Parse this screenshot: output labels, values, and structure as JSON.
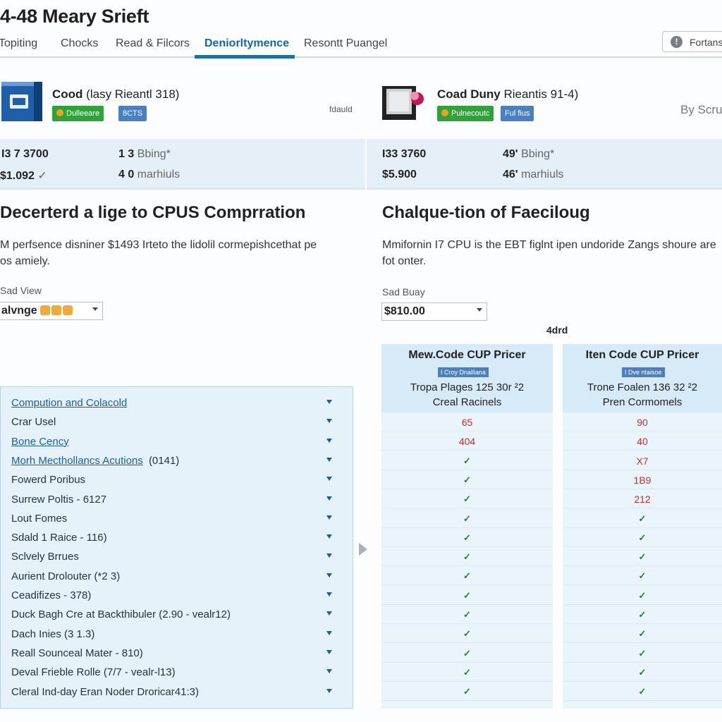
{
  "page": {
    "title": "4-48 Meary Srieft"
  },
  "tabs": [
    {
      "label": "Topiting",
      "active": false
    },
    {
      "label": "Chocks",
      "active": false
    },
    {
      "label": "Read & Filcors",
      "active": false
    },
    {
      "label": "Deniorltymence",
      "active": true
    },
    {
      "label": "Resontt Puangel",
      "active": false
    }
  ],
  "toolbar": {
    "button_label": "Fortans",
    "button_icon": "info-icon"
  },
  "products": [
    {
      "name_bold": "Cood",
      "name_rest": "(lasy  Rieantl  318)",
      "badge_primary": "Dulleeare",
      "badge_secondary": "8CTS",
      "note": "fdauld",
      "spec1_label": "I3 7  3700",
      "spec1_value": "1 3",
      "spec1_unit": "Bbing*",
      "spec2_label": "$1.092",
      "spec2_mark": "✓",
      "spec2_value": "4 0",
      "spec2_unit": "marhiuls",
      "section_title": "Decerterd a lige to CPUS Comprration",
      "section_text": "M perfsence disniner $1493 Irteto the lidolil cormepishcethat pe os amiely.",
      "field_label": "Sad View",
      "field_value": "alvnge",
      "brand_color": "#1d5fa8"
    },
    {
      "name_bold": "Coad Duny",
      "name_rest": "Rieantis 91-4)",
      "badge_primary": "Pulnecoutc",
      "badge_secondary": "Ful fius",
      "scroll_hint": "By Scru",
      "spec1_label": "I33  3760",
      "spec1_value": "49'",
      "spec1_unit": "Bbing*",
      "spec2_label": "$5.900",
      "spec2_value": "46'",
      "spec2_unit": "marhiuls",
      "section_title": "Chalque-tion of Faeciloug",
      "section_text": "Mmifornin I7 CPU is the EBT figlnt ipen undoride Zangs shoure are fot onter.",
      "field_label": "Sad Buay",
      "field_value": "$810.00",
      "brand_color": "#9a1d4f"
    }
  ],
  "aside_label": "4drd",
  "features": [
    {
      "label": "Compution and Colacold",
      "link": true
    },
    {
      "label": "Crar  Usel",
      "link": false
    },
    {
      "label": "Bone Cency",
      "link": true
    },
    {
      "label": "Morh Mecthollancs Acutions",
      "suffix": "(0141)",
      "link": true
    },
    {
      "label": "Fowerd Poribus",
      "link": false
    },
    {
      "label": "Surrew Poltis - 6127",
      "link": false
    },
    {
      "label": "Lout Fomes",
      "link": false
    },
    {
      "label": "Sdald 1 Raice - 116)",
      "link": false
    },
    {
      "label": "Sclvely Brrues",
      "link": false
    },
    {
      "label": "Aurient Drolouter (*2 3)",
      "link": false
    },
    {
      "label": "Ceadifizes - 378)",
      "link": false
    },
    {
      "label": "Duck Bagh Cre at Backthibuler (2.90 - vealr12)",
      "link": false
    },
    {
      "label": "Dach Inies (3 1.3)",
      "link": false
    },
    {
      "label": "Reall Sounceal Mater - 810)",
      "link": false
    },
    {
      "label": "Deval Frieble Rolle (7/7 - vealr-l13)",
      "link": false
    },
    {
      "label": "Cleral Ind-day Eran Noder Droricar41:3)",
      "link": false
    }
  ],
  "compare": [
    {
      "title": "Mew.Code CUP Pricer",
      "tag": "I Croy Dnalliana",
      "line1": "Tropa Plages 125 30r  ²2",
      "line2": "Creal Racinels",
      "values": [
        "65",
        "404",
        "✓",
        "✓",
        "✓",
        "✓",
        "✓",
        "✓",
        "✓",
        "✓",
        "✓",
        "✓",
        "✓",
        "✓",
        "✓"
      ]
    },
    {
      "title": "Iten Code CUP Pricer",
      "tag": "I Dve ntaisoe",
      "line1": "Trone Foalen 136 32  ²2",
      "line2": "Pren Cormomels",
      "values": [
        "90",
        "40",
        "X7",
        "1B9",
        "212",
        "✓",
        "✓",
        "✓",
        "✓",
        "✓",
        "✓",
        "✓",
        "✓",
        "✓",
        "✓"
      ]
    }
  ]
}
